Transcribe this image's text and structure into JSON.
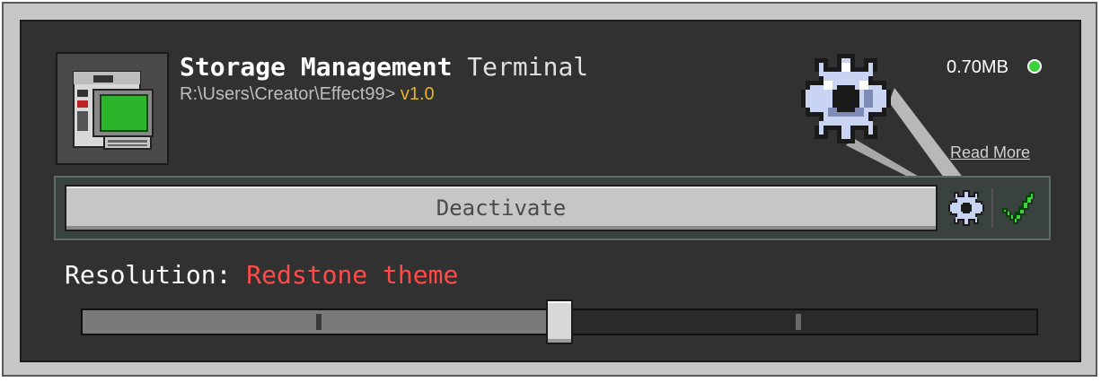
{
  "addon": {
    "name": "Storage Management",
    "name_suffix": "Terminal",
    "path": "R:\\Users\\Creator\\Effect99>",
    "version": "v1.0",
    "size": "0.70MB",
    "status_color": "#3ad13a",
    "read_more": "Read More",
    "icon": "computer-terminal-icon"
  },
  "actions": {
    "deactivate_label": "Deactivate",
    "settings_icon": "gear-icon",
    "confirm_icon": "checkmark-icon"
  },
  "resolution": {
    "label": "Resolution:",
    "value": "Redstone theme",
    "value_color": "#ff4a4a",
    "slider_level": 0.5
  },
  "colors": {
    "panel": "#313131",
    "frame": "#c6c6c6",
    "version": "#e6b422"
  }
}
